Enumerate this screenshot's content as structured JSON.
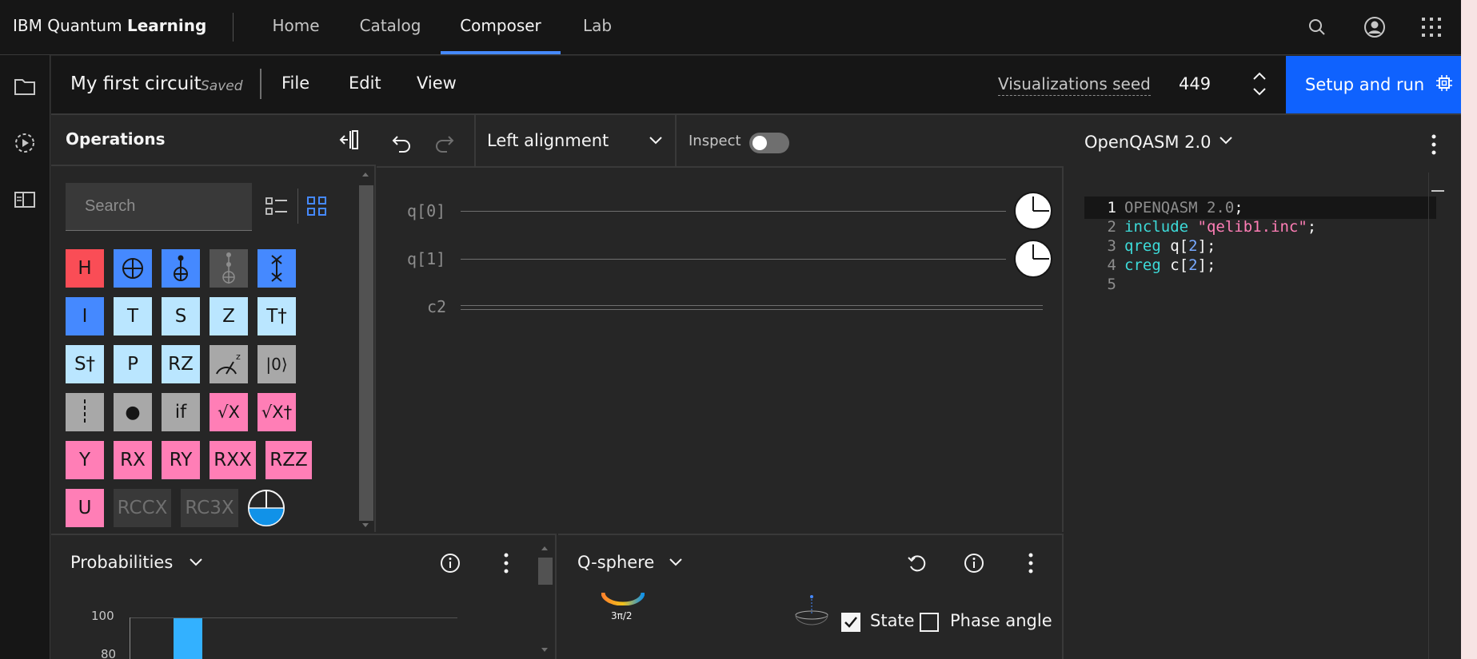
{
  "topnav": {
    "brand_prefix": "IBM Quantum ",
    "brand_bold": "Learning",
    "tabs": [
      {
        "label": "Home",
        "active": false
      },
      {
        "label": "Catalog",
        "active": false
      },
      {
        "label": "Composer",
        "active": true
      },
      {
        "label": "Lab",
        "active": false
      }
    ],
    "icons": [
      "search-icon",
      "user-avatar-icon",
      "app-switcher-icon"
    ]
  },
  "leftrail": {
    "icons": [
      "folder-icon",
      "jobs-icon",
      "docs-panel-icon"
    ]
  },
  "titlebar": {
    "circuit_name": "My first circuit",
    "saved": "Saved",
    "menus": [
      "File",
      "Edit",
      "View"
    ],
    "seed_label": "Visualizations seed",
    "seed_value": "449",
    "run_button": "Setup and run"
  },
  "operations": {
    "title": "Operations",
    "search_placeholder": "Search",
    "gates": [
      {
        "label": "H",
        "style": "red"
      },
      {
        "label": "⊕",
        "style": "blue",
        "icon": "cnot-target-icon"
      },
      {
        "label": "cx",
        "style": "blue",
        "icon": "cnot-icon"
      },
      {
        "label": "ccx",
        "style": "dark",
        "icon": "toffoli-icon"
      },
      {
        "label": "swap",
        "style": "blue",
        "icon": "swap-icon"
      },
      {
        "label": "I",
        "style": "blue"
      },
      {
        "label": "T",
        "style": "light"
      },
      {
        "label": "S",
        "style": "light"
      },
      {
        "label": "Z",
        "style": "light"
      },
      {
        "label": "T†",
        "style": "light"
      },
      {
        "label": "S†",
        "style": "light"
      },
      {
        "label": "P",
        "style": "light"
      },
      {
        "label": "RZ",
        "style": "light"
      },
      {
        "label": "measure",
        "style": "gray",
        "icon": "z-measure-icon"
      },
      {
        "label": "|0⟩",
        "style": "gray"
      },
      {
        "label": "barrier",
        "style": "gray",
        "icon": "barrier-icon"
      },
      {
        "label": "●",
        "style": "gray"
      },
      {
        "label": "if",
        "style": "gray"
      },
      {
        "label": "√X",
        "style": "pink"
      },
      {
        "label": "√X†",
        "style": "pink"
      },
      {
        "label": "Y",
        "style": "pink"
      },
      {
        "label": "RX",
        "style": "pink"
      },
      {
        "label": "RY",
        "style": "pink"
      },
      {
        "label": "RXX",
        "style": "pink"
      },
      {
        "label": "RZZ",
        "style": "pink"
      },
      {
        "label": "U",
        "style": "pink"
      },
      {
        "label": "RCCX",
        "style": "disabled"
      },
      {
        "label": "RC3X",
        "style": "disabled"
      },
      {
        "label": "phase-disk",
        "style": "disk",
        "icon": "phase-disk-icon"
      }
    ]
  },
  "canvas": {
    "alignment": "Left alignment",
    "inspect_label": "Inspect",
    "inspect_on": false,
    "qubits": [
      "q[0]",
      "q[1]"
    ],
    "classical": "c2"
  },
  "code": {
    "language": "OpenQASM 2.0",
    "lines": [
      {
        "n": "1",
        "tokens": [
          {
            "t": "OPENQASM 2.0",
            "c": "muted"
          },
          {
            "t": ";",
            "c": "plain"
          }
        ]
      },
      {
        "n": "2",
        "tokens": [
          {
            "t": "include ",
            "c": "kw"
          },
          {
            "t": "\"qelib1.inc\"",
            "c": "str"
          },
          {
            "t": ";",
            "c": "plain"
          }
        ]
      },
      {
        "n": "3",
        "tokens": [
          {
            "t": "qreg ",
            "c": "kw"
          },
          {
            "t": "q[",
            "c": "plain"
          },
          {
            "t": "2",
            "c": "num"
          },
          {
            "t": "];",
            "c": "plain"
          }
        ]
      },
      {
        "n": "4",
        "tokens": [
          {
            "t": "creg ",
            "c": "kw"
          },
          {
            "t": "c[",
            "c": "plain"
          },
          {
            "t": "2",
            "c": "num"
          },
          {
            "t": "];",
            "c": "plain"
          }
        ]
      },
      {
        "n": "5",
        "tokens": []
      }
    ]
  },
  "probabilities": {
    "title": "Probabilities",
    "yticks": [
      "100",
      "80"
    ]
  },
  "qsphere": {
    "title": "Q-sphere",
    "phase_tick": "3π/2",
    "state_label": "State",
    "state_checked": true,
    "phase_label": "Phase angle",
    "phase_checked": false
  },
  "colors": {
    "accent": "#0f62fe",
    "tab_indicator": "#4589ff",
    "gate_red": "#fa4d56",
    "gate_blue": "#4589ff",
    "gate_light": "#bae6ff",
    "gate_pink": "#ff7eb6",
    "gate_gray": "#a8a8a8",
    "prob_bar": "#33b1ff"
  }
}
